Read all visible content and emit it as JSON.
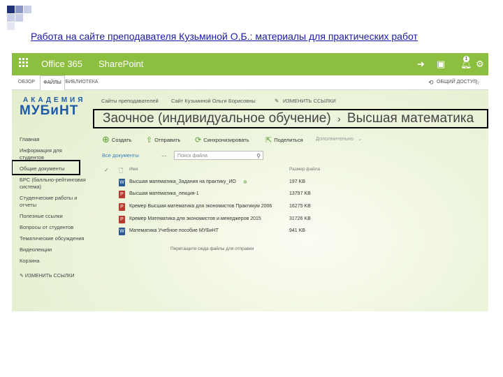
{
  "slide": {
    "title": "Работа на сайте преподавателя Кузьминой О.Б.: материалы для практических работ"
  },
  "suitebar": {
    "office_label": "Office 365",
    "sharepoint_label": "SharePoint",
    "notification_count": "1",
    "color": "#8cbf3f"
  },
  "ribbon": {
    "tabs": [
      "ОБЗОР",
      "ФАЙЛЫ",
      "БИБЛИОТЕКА"
    ],
    "share_label": "ОБЩИЙ ДОСТУП"
  },
  "logo": {
    "line1": "АКАДЕМИЯ",
    "line2": "МУБиНТ"
  },
  "breadcrumb": {
    "item1": "Сайты преподавателей",
    "item2": "Сайт Кузьминой Ольги Борисовны",
    "edit_links": "ИЗМЕНИТЬ ССЫЛКИ"
  },
  "heading": {
    "part1": "Заочное (индивидуальное обучение)",
    "separator": "›",
    "part2": "Высшая математика"
  },
  "nav": {
    "items": [
      "Главная",
      "Информация для студентов",
      "Общие документы",
      "БРС (балльно-рейтинговая система)",
      "Студенческие работы и отчеты",
      "Полезные ссылки",
      "Вопросы от студентов",
      "Тематические обсуждения",
      "Видеолекции",
      "Корзина"
    ],
    "edit_links": "ИЗМЕНИТЬ ССЫЛКИ"
  },
  "commands": {
    "create": "Создать",
    "send": "Отправить",
    "sync": "Синхронизировать",
    "share": "Поделиться",
    "more": "Дополнительно"
  },
  "view": {
    "all_docs": "Все документы",
    "more": "...",
    "search_placeholder": "Поиск файла"
  },
  "table": {
    "col_name": "Имя",
    "col_size": "Размер файла",
    "files": [
      {
        "name": "Высшая математика_Задания на практику_ИО",
        "size": "197 KB",
        "icon": "word-doc-icon"
      },
      {
        "name": "Высшая математика_лекция-1",
        "size": "13797 KB",
        "icon": "pdf-doc-icon"
      },
      {
        "name": "Кремер Высшая математика для экономистов Практикум 2006",
        "size": "16275 KB",
        "icon": "pdf-doc-icon"
      },
      {
        "name": "Кремер Математика для экономистов и менеджеров 2015",
        "size": "31726 KB",
        "icon": "pdf-doc-icon"
      },
      {
        "name": "Математика Учебное пособие МУБиНТ",
        "size": "941 KB",
        "icon": "word-doc-icon"
      }
    ],
    "drop_hint": "Перетащите сюда файлы для отправки"
  }
}
